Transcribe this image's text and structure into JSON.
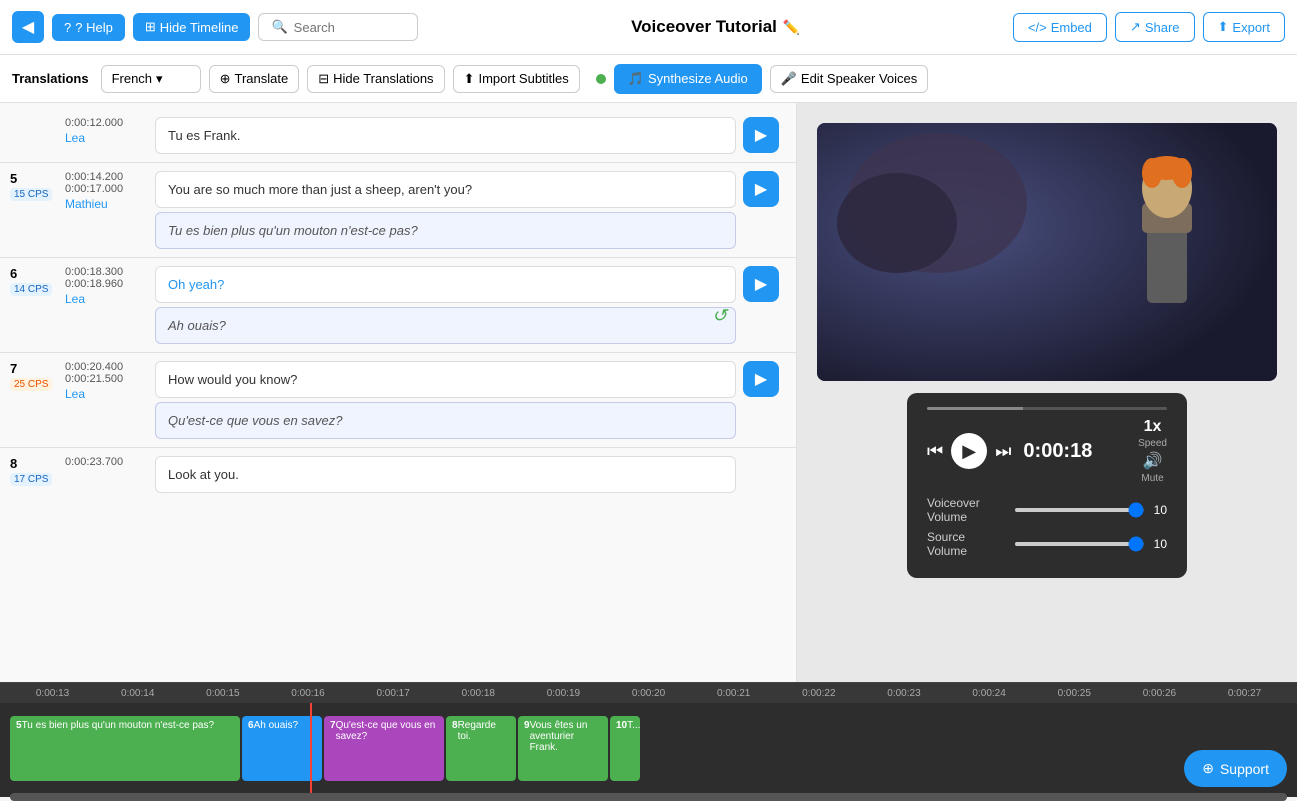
{
  "header": {
    "back_label": "◀",
    "help_label": "? Help",
    "hide_timeline_label": "Hide Timeline",
    "search_placeholder": "Search",
    "title": "Voiceover Tutorial",
    "embed_label": "Embed",
    "share_label": "Share",
    "export_label": "Export"
  },
  "toolbar": {
    "translations_label": "Translations",
    "language": "French",
    "translate_label": "Translate",
    "hide_translations_label": "Hide Translations",
    "import_subtitles_label": "Import Subtitles",
    "synthesize_label": "Synthesize Audio",
    "edit_speaker_label": "Edit Speaker Voices"
  },
  "subtitles": [
    {
      "number": "5",
      "cps": "15 CPS",
      "cps_type": "normal",
      "time_start": "0:00:14.200",
      "time_end": "0:00:17.000",
      "speaker": "Mathieu",
      "original": "You are so much more than just a sheep, aren't you?",
      "translation": "Tu es bien plus qu'un mouton n'est-ce pas?"
    },
    {
      "number": "6",
      "cps": "14 CPS",
      "cps_type": "normal",
      "time_start": "0:00:18.300",
      "time_end": "0:00:18.960",
      "speaker": "Lea",
      "original": "Oh yeah?",
      "translation": "Ah ouais?"
    },
    {
      "number": "7",
      "cps": "25 CPS",
      "cps_type": "yellow",
      "time_start": "0:00:20.400",
      "time_end": "0:00:21.500",
      "speaker": "Lea",
      "original": "How would you know?",
      "translation": "Qu'est-ce que vous en savez?"
    },
    {
      "number": "8",
      "cps": "17 CPS",
      "cps_type": "normal",
      "time_start": "0:00:23.700",
      "time_end": "",
      "speaker": "",
      "original": "Look at you.",
      "translation": ""
    }
  ],
  "player": {
    "time": "0:00:18",
    "speed": "1x",
    "speed_label": "Speed",
    "mute_label": "Mute",
    "voiceover_volume_label": "Voiceover Volume",
    "voiceover_volume": "10",
    "source_volume_label": "Source Volume",
    "source_volume": "10"
  },
  "timeline": {
    "ruler_ticks": [
      "0:00:13",
      "0:00:14",
      "0:00:15",
      "0:00:16",
      "0:00:17",
      "0:00:18",
      "0:00:19",
      "0:00:20",
      "0:00:21",
      "0:00:22",
      "0:00:23",
      "0:00:24",
      "0:00:25",
      "0:00:26",
      "0:00:27"
    ],
    "clips": [
      {
        "id": "5",
        "text": "Tu es bien plus qu'un mouton n'est-ce pas?"
      },
      {
        "id": "6",
        "text": "Ah ouais?"
      },
      {
        "id": "7",
        "text": "Qu'est-ce que vous en savez?"
      },
      {
        "id": "8",
        "text": "Regarde toi."
      },
      {
        "id": "9",
        "text": "Vous êtes un aventurier Frank."
      },
      {
        "id": "10",
        "text": "T..."
      }
    ]
  },
  "support": {
    "label": "Support"
  },
  "earlier_subtitle": {
    "time": "0:00:12.000",
    "speaker": "Lea",
    "text": "Tu es Frank."
  }
}
